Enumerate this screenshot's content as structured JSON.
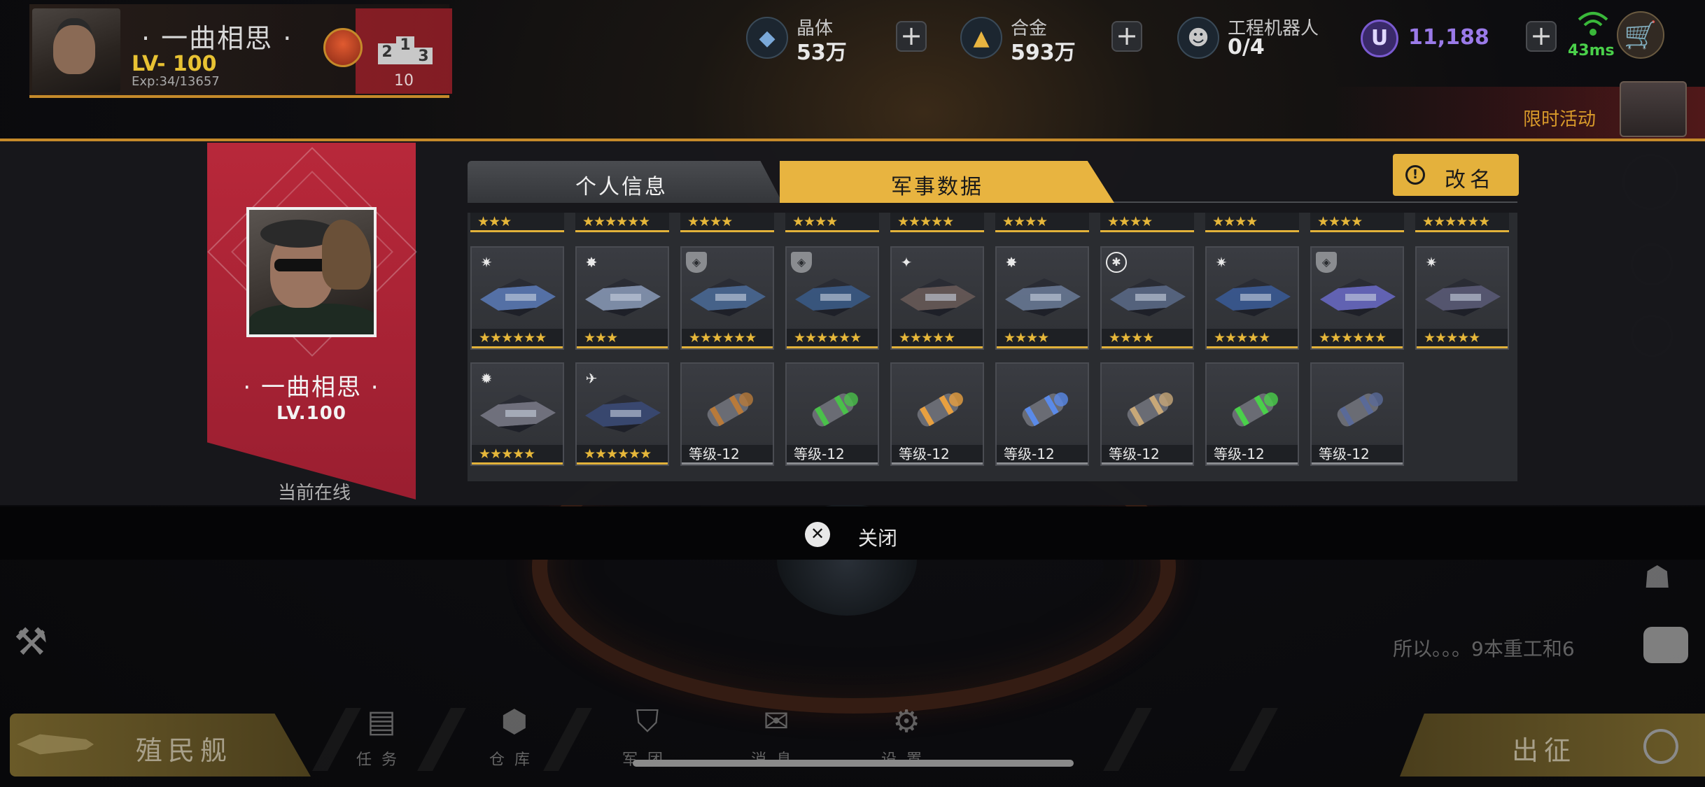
{
  "hud": {
    "player": {
      "name": "· 一曲相思 ·",
      "level": "LV- 100",
      "exp": "Exp:34/13657"
    },
    "rank": {
      "count": "10",
      "podium": [
        "2",
        "1",
        "3"
      ]
    },
    "resources": [
      {
        "icon": "crystal-icon",
        "label": "晶体",
        "value": "53万"
      },
      {
        "icon": "alloy-icon",
        "label": "合金",
        "value": "593万"
      },
      {
        "icon": "robot-icon",
        "label": "工程机器人",
        "value": "0/4"
      }
    ],
    "currency": {
      "icon_text": "U",
      "value": "11,188"
    },
    "ping": "43ms",
    "event_label": "限时活动"
  },
  "profile": {
    "name": "· 一曲相思 ·",
    "level": "LV.100",
    "status": "当前在线"
  },
  "tabs": [
    {
      "label": "个人信息",
      "active": false
    },
    {
      "label": "军事数据",
      "active": true
    }
  ],
  "rename": {
    "label": "改名",
    "icon_text": "!"
  },
  "grid": {
    "partial_row_stars": [
      "★★★",
      "★★★★★★",
      "★★★★",
      "★★★★",
      "★★★★★",
      "★★★★",
      "★★★★",
      "★★★★",
      "★★★★",
      "★★★★★★"
    ],
    "row1": [
      {
        "badge": "✷",
        "badge_type": "plain",
        "footer": "★★★★★★",
        "hue": "#5a7ab8"
      },
      {
        "badge": "✸",
        "badge_type": "plain",
        "footer": "★★★",
        "hue": "#8a9ab8"
      },
      {
        "badge": "◈",
        "badge_type": "shield",
        "footer": "★★★★★★",
        "hue": "#4a6a98"
      },
      {
        "badge": "◈",
        "badge_type": "shield",
        "footer": "★★★★★★",
        "hue": "#3a5a88"
      },
      {
        "badge": "✦",
        "badge_type": "plain",
        "footer": "★★★★★",
        "hue": "#6a5a58"
      },
      {
        "badge": "✸",
        "badge_type": "plain",
        "footer": "★★★★",
        "hue": "#6a7a98"
      },
      {
        "badge": "✱",
        "badge_type": "circle",
        "footer": "★★★★",
        "hue": "#5a6a88"
      },
      {
        "badge": "✷",
        "badge_type": "plain",
        "footer": "★★★★★",
        "hue": "#3a5a98"
      },
      {
        "badge": "◈",
        "badge_type": "shield",
        "footer": "★★★★★★",
        "hue": "#6a6ac8"
      },
      {
        "badge": "✷",
        "badge_type": "plain",
        "footer": "★★★★★",
        "hue": "#5a5a78"
      }
    ],
    "row2": [
      {
        "badge": "✹",
        "badge_type": "plain",
        "footer": "★★★★★",
        "kind": "ship",
        "hue": "#7a7a88"
      },
      {
        "badge": "✈",
        "badge_type": "plain",
        "footer": "★★★★★★",
        "kind": "ship",
        "hue": "#3a4a78"
      },
      {
        "footer": "等级-12",
        "kind": "module",
        "hue": "#b87a3a"
      },
      {
        "footer": "等级-12",
        "kind": "module",
        "hue": "#4ac04a"
      },
      {
        "footer": "等级-12",
        "kind": "module",
        "hue": "#e8a040"
      },
      {
        "footer": "等级-12",
        "kind": "module",
        "hue": "#5a8ae8"
      },
      {
        "footer": "等级-12",
        "kind": "module",
        "hue": "#c8a878"
      },
      {
        "footer": "等级-12",
        "kind": "module",
        "hue": "#4ad04a"
      },
      {
        "footer": "等级-12",
        "kind": "module",
        "hue": "#5a6a98"
      }
    ]
  },
  "close": {
    "label": "关闭",
    "icon_text": "✕"
  },
  "chat_preview": "所以。。。9本重工和6",
  "bottom": {
    "colony": "殖民舰",
    "deploy": "出征",
    "nav": [
      {
        "label": "任务",
        "icon": "task-icon"
      },
      {
        "label": "仓库",
        "icon": "warehouse-icon"
      },
      {
        "label": "军团",
        "icon": "legion-icon"
      },
      {
        "label": "消息",
        "icon": "message-icon"
      },
      {
        "label": "设置",
        "icon": "settings-icon"
      }
    ]
  }
}
